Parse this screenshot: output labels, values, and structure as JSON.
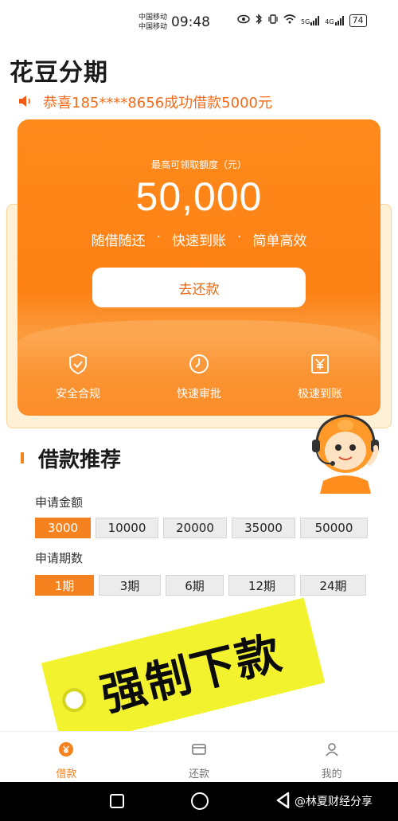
{
  "status_bar": {
    "carrier_1": "中国移动",
    "carrier_2": "中国移动",
    "time": "09:48",
    "battery": "74",
    "signal_1": "5G",
    "signal_2": "4G"
  },
  "header": {
    "title": "花豆分期",
    "notice": "恭喜185****8656成功借款5000元"
  },
  "card": {
    "quota_label": "最高可领取额度（元）",
    "quota_amount": "50,000",
    "features": [
      "随借随还",
      "快速到账",
      "简单高效"
    ],
    "feature_separator": "·",
    "repay_button": "去还款",
    "badges": [
      {
        "label": "安全合规",
        "icon": "shield-check-icon"
      },
      {
        "label": "快速审批",
        "icon": "clock-icon"
      },
      {
        "label": "极速到账",
        "icon": "yuan-icon"
      }
    ]
  },
  "recommend": {
    "title": "借款推荐",
    "amount_label": "申请金额",
    "amount_options": [
      "3000",
      "10000",
      "20000",
      "35000",
      "50000"
    ],
    "amount_selected": "3000",
    "period_label": "申请期数",
    "period_options": [
      "1期",
      "3期",
      "6期",
      "12期",
      "24期"
    ],
    "period_selected": "1期"
  },
  "stamp": {
    "text": "强制下款"
  },
  "tabs": [
    {
      "label": "借款",
      "icon": "loan-icon",
      "active": true
    },
    {
      "label": "还款",
      "icon": "card-icon",
      "active": false
    },
    {
      "label": "我的",
      "icon": "user-icon",
      "active": false
    }
  ],
  "watermark": "@林夏财经分享",
  "colors": {
    "accent": "#f5821f",
    "card_orange": "#fd8115",
    "stamp_yellow": "#f3f22f"
  }
}
